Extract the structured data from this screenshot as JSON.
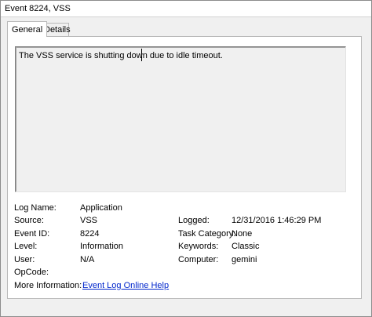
{
  "window": {
    "title": "Event 8224, VSS"
  },
  "tabs": [
    {
      "label": "General"
    },
    {
      "label": "Details"
    }
  ],
  "message": "The VSS service is shutting down due to idle timeout.",
  "fields": {
    "log_name_label": "Log Name:",
    "log_name_value": "Application",
    "source_label": "Source:",
    "source_value": "VSS",
    "logged_label": "Logged:",
    "logged_value": "12/31/2016 1:46:29 PM",
    "event_id_label": "Event ID:",
    "event_id_value": "8224",
    "task_category_label": "Task Category:",
    "task_category_value": "None",
    "level_label": "Level:",
    "level_value": "Information",
    "keywords_label": "Keywords:",
    "keywords_value": "Classic",
    "user_label": "User:",
    "user_value": "N/A",
    "computer_label": "Computer:",
    "computer_value": "gemini",
    "opcode_label": "OpCode:",
    "opcode_value": "",
    "more_info_label": "More Information:",
    "more_info_link": "Event Log Online Help"
  },
  "colors": {
    "link": "#0026cc",
    "panel_bg": "#ffffff",
    "window_bg": "#f0f0f0"
  }
}
